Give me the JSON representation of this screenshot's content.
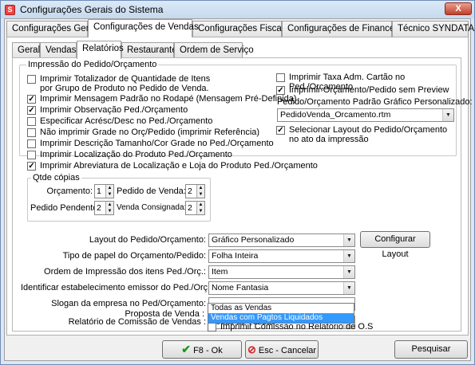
{
  "window": {
    "title": "Configurações Gerais do Sistema",
    "close_label": "X"
  },
  "main_tabs": [
    {
      "label": "Configurações Gerais"
    },
    {
      "label": "Configurações de Vendas"
    },
    {
      "label": "Configurações Fiscais"
    },
    {
      "label": "Configurações de Financeiro"
    },
    {
      "label": "Técnico SYNDATA"
    }
  ],
  "sub_tabs": [
    {
      "label": "Geral"
    },
    {
      "label": "Vendas"
    },
    {
      "label": "Relatórios"
    },
    {
      "label": "Restaurante"
    },
    {
      "label": "Ordem de Serviço"
    }
  ],
  "print_group": {
    "title": "Impressão do Pedido/Orçamento",
    "left_checks": [
      {
        "label": "Imprimir Totalizador de Quantidade de Itens por Grupo de Produto no Pedido de Venda.",
        "checked": false
      },
      {
        "label": "Imprimir Mensagem Padrão no Rodapé (Mensagem Pré-Definida)",
        "checked": true
      },
      {
        "label": "Imprimir Observação Ped./Orçamento",
        "checked": true
      },
      {
        "label": "Especificar Acrésc/Desc no Ped./Orçamento",
        "checked": false
      },
      {
        "label": "Não imprimir Grade no Orç/Pedido (imprimir Referência)",
        "checked": false
      },
      {
        "label": "Imprimir Descrição Tamanho/Cor Grade no Ped./Orçamento",
        "checked": false
      },
      {
        "label": "Imprimir Localização do Produto Ped./Orçamento",
        "checked": false
      },
      {
        "label": "Imprimir Abreviatura de Localização e Loja do Produto Ped./Orçamento",
        "checked": true
      }
    ],
    "right_checks": [
      {
        "label": "Imprimir Taxa Adm. Cartão no Ped./Orçamento",
        "checked": false
      },
      {
        "label": "Imprimir Orçamento/Pedido sem Preview",
        "checked": true
      }
    ],
    "graphic_label": "Pedido/Orçamento Padrão Gráfico Personalizado:",
    "graphic_value": "PedidoVenda_Orcamento.rtm",
    "select_layout_check": {
      "label": "Selecionar Layout do Pedido/Orçamento no ato da impressão",
      "checked": true
    },
    "check_mark": "✓"
  },
  "copies": {
    "title": "Qtde cópias",
    "orcamento_label": "Orçamento:",
    "orcamento_value": "1",
    "pedido_venda_label": "Pedido de Venda:",
    "pedido_venda_value": "2",
    "pedido_pendente_label": "Pedido Pendente:",
    "pedido_pendente_value": "2",
    "venda_consignada_label": "Venda Consignada:",
    "venda_consignada_value": "2"
  },
  "form": {
    "layout_label": "Layout do Pedido/Orçamento:",
    "layout_value": "Gráfico Personalizado",
    "configure_layout_label": "Configurar Layout",
    "paper_label": "Tipo de papel do Orçamento/Pedido:",
    "paper_value": "Folha Inteira",
    "order_label": "Ordem de Impressão dos itens Ped./Orç.:",
    "order_value": "Item",
    "identify_label": "Identificar estabelecimento emissor do Ped./Orç.:",
    "identify_value": "Nome Fantasia",
    "slogan_label": "Slogan da empresa no Ped/Orçamento:",
    "slogan_value": "",
    "commission_label": "Relatório de Comissão de Vendas :",
    "commission_value": "Todas as Vendas",
    "commission_options": [
      "Todas as Vendas",
      "Vendas com Pagtos Liquidados"
    ],
    "proposal_label": "Proposta de Venda :",
    "print_commission_check": {
      "label": "Imprimir Comissão no Relatório de O.S",
      "checked": false
    }
  },
  "footer": {
    "ok_label": "F8 - Ok",
    "cancel_label": "Esc - Cancelar",
    "search_label": "Pesquisar"
  }
}
